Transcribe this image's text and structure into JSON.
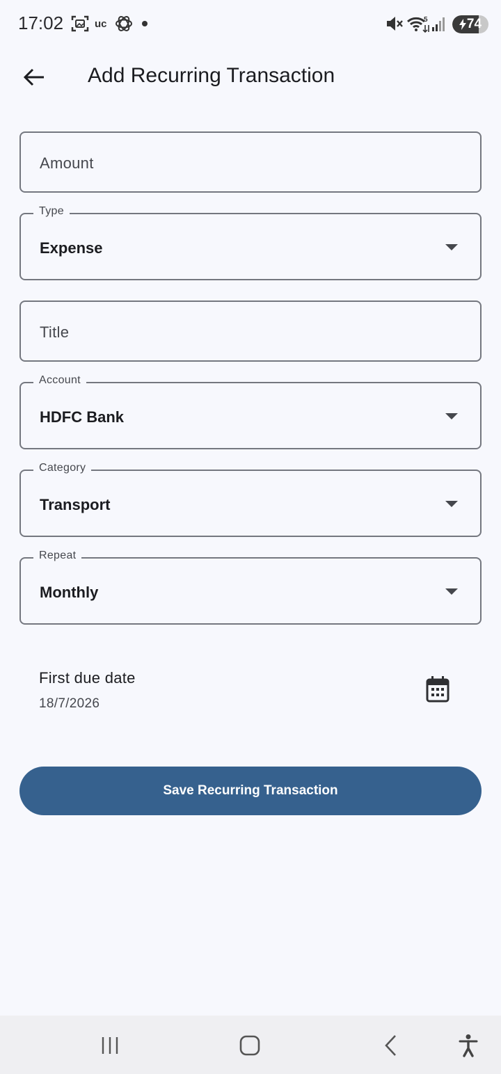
{
  "status_bar": {
    "time": "17:02",
    "uc_label": "uc",
    "wifi_label": "5",
    "battery_percent": "74",
    "battery_level": 0.74,
    "icons": [
      "screenshot-icon",
      "uc-browser-icon",
      "openai-icon",
      "notification-dot-icon",
      "mute-icon",
      "wifi-icon",
      "signal-icon",
      "battery-icon"
    ]
  },
  "app_bar": {
    "title": "Add Recurring Transaction",
    "back_icon": "arrow-back-icon"
  },
  "form": {
    "amount": {
      "placeholder": "Amount"
    },
    "type": {
      "label": "Type",
      "value": "Expense"
    },
    "title": {
      "placeholder": "Title"
    },
    "account": {
      "label": "Account",
      "value": "HDFC Bank"
    },
    "category": {
      "label": "Category",
      "value": "Transport"
    },
    "repeat": {
      "label": "Repeat",
      "value": "Monthly"
    },
    "first_due": {
      "label": "First due date",
      "value": "18/7/2026",
      "icon": "calendar-icon"
    }
  },
  "save_button": {
    "label": "Save Recurring Transaction"
  },
  "nav_bar": {
    "icons": [
      "recent-apps-icon",
      "home-icon",
      "back-icon",
      "accessibility-icon"
    ]
  },
  "colors": {
    "background": "#f7f8fd",
    "primary": "#36618e",
    "outline": "#74777f",
    "text": "#1b1c20",
    "nav_background": "#efeff2"
  }
}
